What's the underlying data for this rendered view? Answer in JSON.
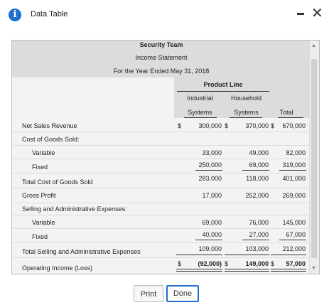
{
  "window": {
    "title": "Data Table",
    "minimize": "–",
    "close": "✕"
  },
  "statement": {
    "company": "Security Team",
    "name": "Income Statement",
    "period": "For the Year Ended May 31, 2018"
  },
  "header": {
    "product_line": "Product Line",
    "col1_line1": "Industrial",
    "col1_line2": "Systems",
    "col2_line1": "Household",
    "col2_line2": "Systems",
    "col3": "Total"
  },
  "rows": {
    "net_sales": {
      "label": "Net Sales Revenue",
      "c1": "300,000",
      "c2": "370,000",
      "c3": "670,000",
      "cur1": "$",
      "cur2": "$",
      "cur3": "$"
    },
    "cogs": {
      "label": "Cost of Goods Sold:"
    },
    "cogs_var": {
      "label": "Variable",
      "c1": "33,000",
      "c2": "49,000",
      "c3": "82,000"
    },
    "cogs_fix": {
      "label": "Fixed",
      "c1": "250,000",
      "c2": "69,000",
      "c3": "319,000"
    },
    "cogs_total": {
      "label": "Total Cost of Goods Sold",
      "c1": "283,000",
      "c2": "118,000",
      "c3": "401,000"
    },
    "gross_profit": {
      "label": "Gross Profit",
      "c1": "17,000",
      "c2": "252,000",
      "c3": "269,000"
    },
    "sga": {
      "label": "Selling and Administrative Expenses:"
    },
    "sga_var": {
      "label": "Variable",
      "c1": "69,000",
      "c2": "76,000",
      "c3": "145,000"
    },
    "sga_fix": {
      "label": "Fixed",
      "c1": "40,000",
      "c2": "27,000",
      "c3": "67,000"
    },
    "sga_total": {
      "label": "Total Selling and Administrative Expenses",
      "c1": "109,000",
      "c2": "103,000",
      "c3": "212,000"
    },
    "op_income": {
      "label": "Operating Income (Loss)",
      "c1": "(92,000)",
      "c2": "149,000",
      "c3": "57,000",
      "cur1": "$",
      "cur2": "$",
      "cur3": "$"
    }
  },
  "buttons": {
    "print": "Print",
    "done": "Done"
  },
  "colors": {
    "accent": "#1f6fd1",
    "header_band": "#dcdcdc",
    "table_bg": "#f3f3f3"
  }
}
